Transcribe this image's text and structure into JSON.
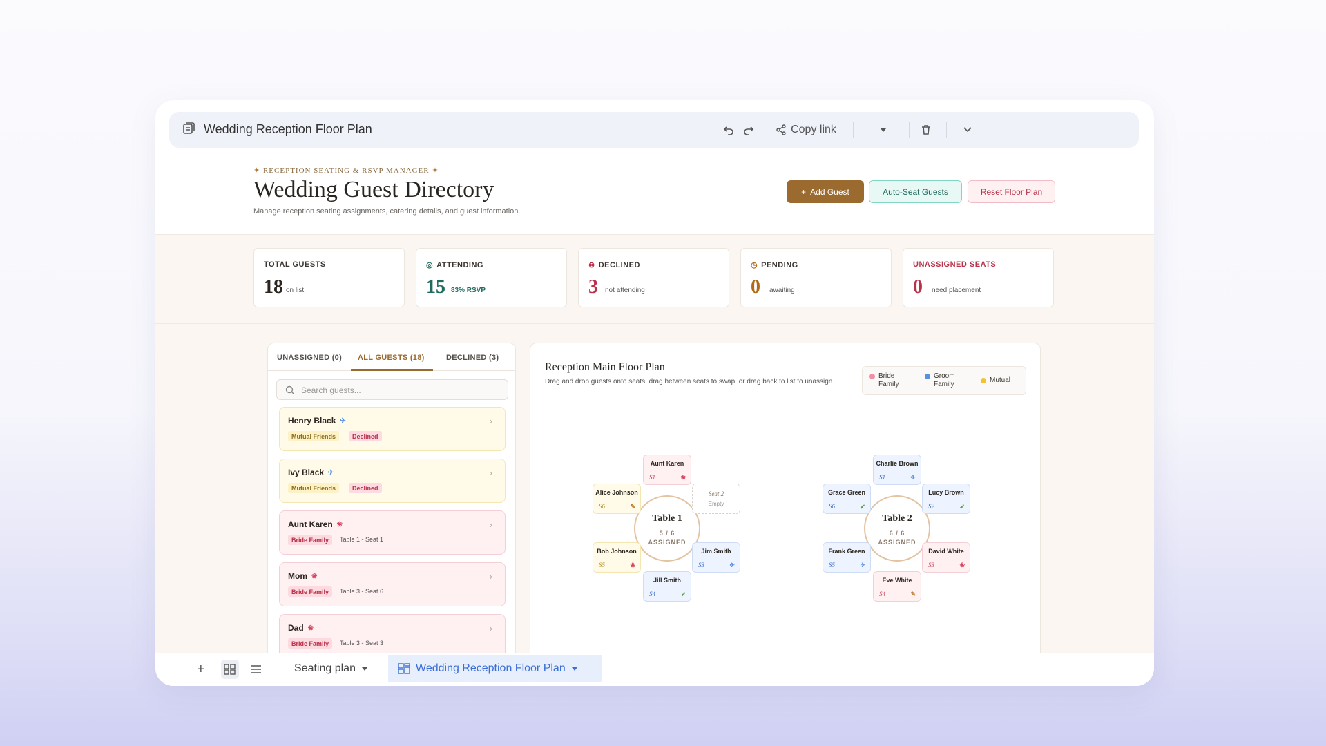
{
  "window": {
    "title": "Wedding Reception Floor Plan",
    "copy_link": "Copy link"
  },
  "header": {
    "eyebrow": "RECEPTION SEATING & RSVP MANAGER",
    "title": "Wedding Guest Directory",
    "subtitle": "Manage reception seating assignments, catering details, and guest information.",
    "add_guest": "Add Guest",
    "auto_seat": "Auto-Seat Guests",
    "reset_floor": "Reset Floor Plan"
  },
  "stats": [
    {
      "label": "TOTAL GUESTS",
      "value": "18",
      "sub": "on list",
      "color": "#2b2620"
    },
    {
      "label": "ATTENDING",
      "value": "15",
      "sub": "83% RSVP",
      "color": "#1f6b5c"
    },
    {
      "label": "DECLINED",
      "value": "3",
      "sub": "not attending",
      "color": "#b8324a"
    },
    {
      "label": "PENDING",
      "value": "0",
      "sub": "awaiting",
      "color": "#b06a1a"
    },
    {
      "label": "UNASSIGNED SEATS",
      "value": "0",
      "sub": "need placement",
      "color": "#b8324a"
    }
  ],
  "guest_list": {
    "tabs": [
      "UNASSIGNED (0)",
      "ALL GUESTS (18)",
      "DECLINED (3)"
    ],
    "active_tab": "ALL GUESTS (18)",
    "search_placeholder": "Search guests...",
    "guests": [
      {
        "name": "Henry Black",
        "group": "Mutual Friends",
        "status": "Declined",
        "seat": ""
      },
      {
        "name": "Ivy Black",
        "group": "Mutual Friends",
        "status": "Declined",
        "seat": ""
      },
      {
        "name": "Aunt Karen",
        "group": "Bride Family",
        "status": "",
        "seat": "Table 1 - Seat 1"
      },
      {
        "name": "Mom",
        "group": "Bride Family",
        "status": "",
        "seat": "Table 3 - Seat 6"
      },
      {
        "name": "Dad",
        "group": "Bride Family",
        "status": "",
        "seat": "Table 3 - Seat 3"
      }
    ]
  },
  "floor_plan": {
    "title": "Reception Main Floor Plan",
    "description": "Drag and drop guests onto seats, drag between seats to swap, or drag back to list to unassign.",
    "legend": [
      {
        "label": "Bride Family",
        "color": "#f08fa5"
      },
      {
        "label": "Groom Family",
        "color": "#5b8fe0"
      },
      {
        "label": "Mutual",
        "color": "#f2c230"
      }
    ],
    "tables": [
      {
        "name": "Table 1",
        "assigned": "5 / 6",
        "assigned_label": "ASSIGNED",
        "seats": [
          {
            "seat": "S1",
            "guest": "Aunt Karen",
            "group": "bride"
          },
          {
            "seat": "S2",
            "guest": "Seat 2",
            "group": "empty",
            "empty_label": "Empty"
          },
          {
            "seat": "S3",
            "guest": "Jim Smith",
            "group": "groom"
          },
          {
            "seat": "S4",
            "guest": "Jill Smith",
            "group": "groom"
          },
          {
            "seat": "S5",
            "guest": "Bob Johnson",
            "group": "mutual"
          },
          {
            "seat": "S6",
            "guest": "Alice Johnson",
            "group": "mutual"
          }
        ]
      },
      {
        "name": "Table 2",
        "assigned": "6 / 6",
        "assigned_label": "ASSIGNED",
        "seats": [
          {
            "seat": "S1",
            "guest": "Charlie Brown",
            "group": "groom"
          },
          {
            "seat": "S2",
            "guest": "Lucy Brown",
            "group": "groom"
          },
          {
            "seat": "S3",
            "guest": "David White",
            "group": "bride"
          },
          {
            "seat": "S4",
            "guest": "Eve White",
            "group": "bride"
          },
          {
            "seat": "S5",
            "guest": "Frank Green",
            "group": "groom"
          },
          {
            "seat": "S6",
            "guest": "Grace Green",
            "group": "groom"
          }
        ]
      }
    ]
  },
  "bottom_bar": {
    "sheet1": "Seating plan",
    "sheet2": "Wedding Reception Floor Plan"
  }
}
